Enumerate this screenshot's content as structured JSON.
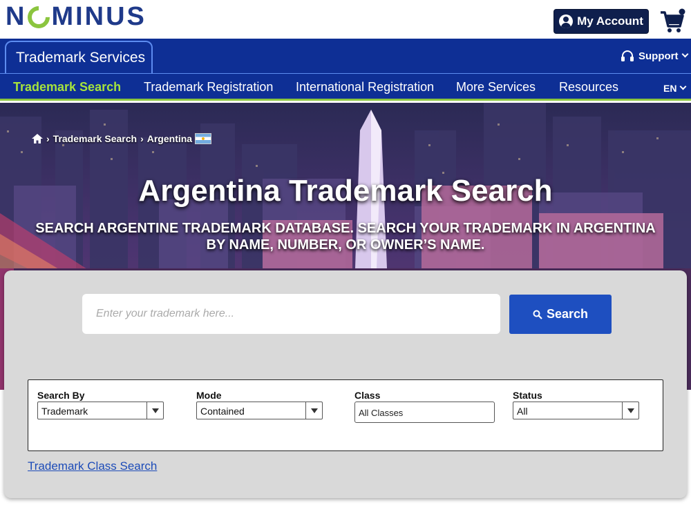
{
  "header": {
    "logo_text": "NOMINUS",
    "account_label": "My Account"
  },
  "service_bar": {
    "tab_label": "Trademark Services",
    "support_label": "Support"
  },
  "nav": {
    "items": [
      {
        "label": "Trademark Search",
        "active": true
      },
      {
        "label": "Trademark Registration",
        "active": false
      },
      {
        "label": "International Registration",
        "active": false
      },
      {
        "label": "More Services",
        "active": false
      },
      {
        "label": "Resources",
        "active": false
      }
    ],
    "language": "EN"
  },
  "hero": {
    "breadcrumb": [
      "Trademark Search",
      "Argentina"
    ],
    "title": "Argentina Trademark Search",
    "subtitle_line1": "SEARCH ARGENTINE TRADEMARK DATABASE. SEARCH YOUR TRADEMARK IN ARGENTINA",
    "subtitle_line2": "BY NAME, NUMBER, OR OWNER’S NAME."
  },
  "search": {
    "placeholder": "Enter your trademark here...",
    "value": "",
    "button_label": "Search"
  },
  "filters": {
    "search_by": {
      "label": "Search By",
      "selected": "Trademark"
    },
    "mode": {
      "label": "Mode",
      "selected": "Contained"
    },
    "class": {
      "label": "Class",
      "value": "All Classes"
    },
    "status": {
      "label": "Status",
      "selected": "All"
    }
  },
  "links": {
    "class_search": "Trademark Class Search"
  },
  "colors": {
    "brand_navy": "#0e2f95",
    "accent_green": "#8bc53f",
    "button_blue": "#1e4fc0"
  }
}
